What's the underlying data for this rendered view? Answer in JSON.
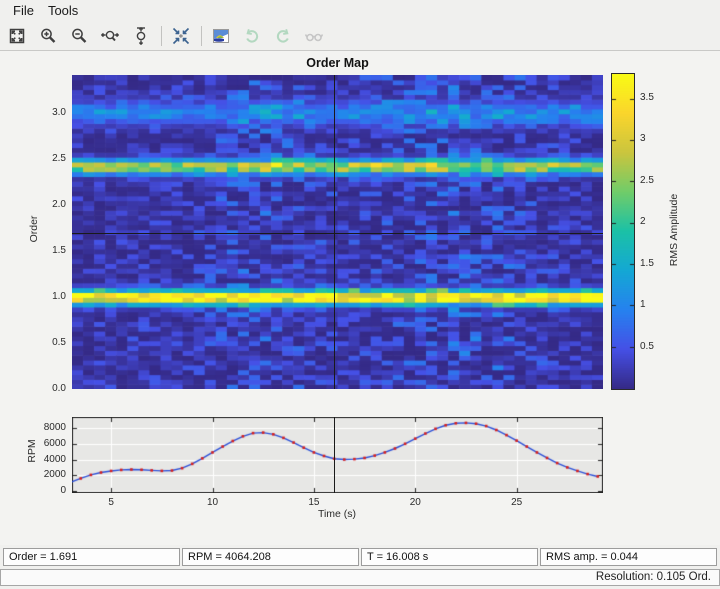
{
  "menu": {
    "items": [
      "File",
      "Tools"
    ]
  },
  "toolbar": {
    "icons": [
      "fit-to-window",
      "zoom-in",
      "zoom-out",
      "zoom-in-x",
      "zoom-in-y",
      "restore-view",
      "colormap-surface",
      "undo",
      "redo",
      "hide-annotations"
    ],
    "disabled_icons": [
      "undo",
      "redo",
      "hide-annotations"
    ]
  },
  "status": {
    "items": [
      "Order = 1.691",
      "RPM = 4064.208",
      "T = 16.008 s",
      "RMS amp. = 0.044"
    ],
    "resolution": "Resolution: 0.105 Ord."
  },
  "colors": {
    "chrome_bg": "#f0f0ee",
    "crosshair": "#1a1a1a",
    "rpm_line": "#2b4fd8",
    "rpm_marker": "#d42020",
    "rpm_plot_bg": "#e7e7e5",
    "grid": "#ffffff",
    "axes_border": "#262626",
    "parula_stops": [
      [
        0.0,
        "#352a87"
      ],
      [
        0.125,
        "#4550e6"
      ],
      [
        0.25,
        "#2682ef"
      ],
      [
        0.375,
        "#14a8d4"
      ],
      [
        0.5,
        "#1bc1a7"
      ],
      [
        0.625,
        "#70cc6a"
      ],
      [
        0.75,
        "#cac53e"
      ],
      [
        0.875,
        "#fad52c"
      ],
      [
        1.0,
        "#f9fb15"
      ]
    ]
  },
  "chart_data": [
    {
      "type": "heatmap",
      "title": "Order Map",
      "ylabel": "Order",
      "xlim": [
        3.07,
        29.26
      ],
      "ylim": [
        0,
        3.41
      ],
      "yticks": [
        0.0,
        0.5,
        1.0,
        1.5,
        2.0,
        2.5,
        3.0
      ],
      "ytick_labels": [
        "0.0",
        "0.5",
        "1.0",
        "1.5",
        "2.0",
        "2.5",
        "3.0"
      ],
      "grid": false,
      "colormap": "parula",
      "colorbar": {
        "label": "RMS Amplitude",
        "ticks": [
          0.5,
          1,
          1.5,
          2,
          2.5,
          3,
          3.5
        ],
        "tick_labels": [
          "0.5",
          "1",
          "1.5",
          "2",
          "2.5",
          "3",
          "3.5"
        ],
        "range": [
          0,
          3.8
        ],
        "position": "right"
      },
      "bands": [
        {
          "order": 1.0,
          "peak_rms": 3.6,
          "sigma": 0.055
        },
        {
          "order": 2.42,
          "peak_rms": 2.6,
          "sigma": 0.055
        },
        {
          "order": 3.0,
          "peak_rms": 0.8,
          "sigma": 0.09
        }
      ],
      "background_rms_range": [
        0,
        0.5
      ],
      "bins": {
        "time": 48,
        "order": 65
      },
      "cursor": {
        "time": 16.008,
        "order": 1.691,
        "rms": 0.044,
        "rpm": 4064.208
      }
    },
    {
      "type": "line",
      "ylabel": "RPM",
      "xlabel": "Time (s)",
      "xlim": [
        3.07,
        29.26
      ],
      "ylim": [
        -250,
        9400
      ],
      "xticks": [
        5,
        10,
        15,
        20,
        25
      ],
      "yticks": [
        0,
        2000,
        4000,
        6000,
        8000
      ],
      "grid": true,
      "marker": "dot",
      "x": [
        3,
        3.5,
        4,
        4.5,
        5,
        5.5,
        6,
        6.5,
        7,
        7.5,
        8,
        8.5,
        9,
        9.5,
        10,
        10.5,
        11,
        11.5,
        12,
        12.5,
        13,
        13.5,
        14,
        14.5,
        15,
        15.5,
        16,
        16.5,
        17,
        17.5,
        18,
        18.5,
        19,
        19.5,
        20,
        20.5,
        21,
        21.5,
        22,
        22.5,
        23,
        23.5,
        24,
        24.5,
        25,
        25.5,
        26,
        26.5,
        27,
        27.5,
        28,
        28.5,
        29
      ],
      "y": [
        1100,
        1600,
        2050,
        2350,
        2550,
        2680,
        2730,
        2700,
        2620,
        2560,
        2600,
        2900,
        3450,
        4150,
        4900,
        5650,
        6350,
        6950,
        7350,
        7420,
        7200,
        6750,
        6150,
        5500,
        4900,
        4450,
        4100,
        4000,
        4050,
        4200,
        4500,
        4900,
        5400,
        6000,
        6650,
        7300,
        7900,
        8350,
        8600,
        8650,
        8550,
        8250,
        7750,
        7100,
        6400,
        5650,
        4900,
        4200,
        3550,
        3000,
        2550,
        2150,
        1850
      ]
    }
  ]
}
